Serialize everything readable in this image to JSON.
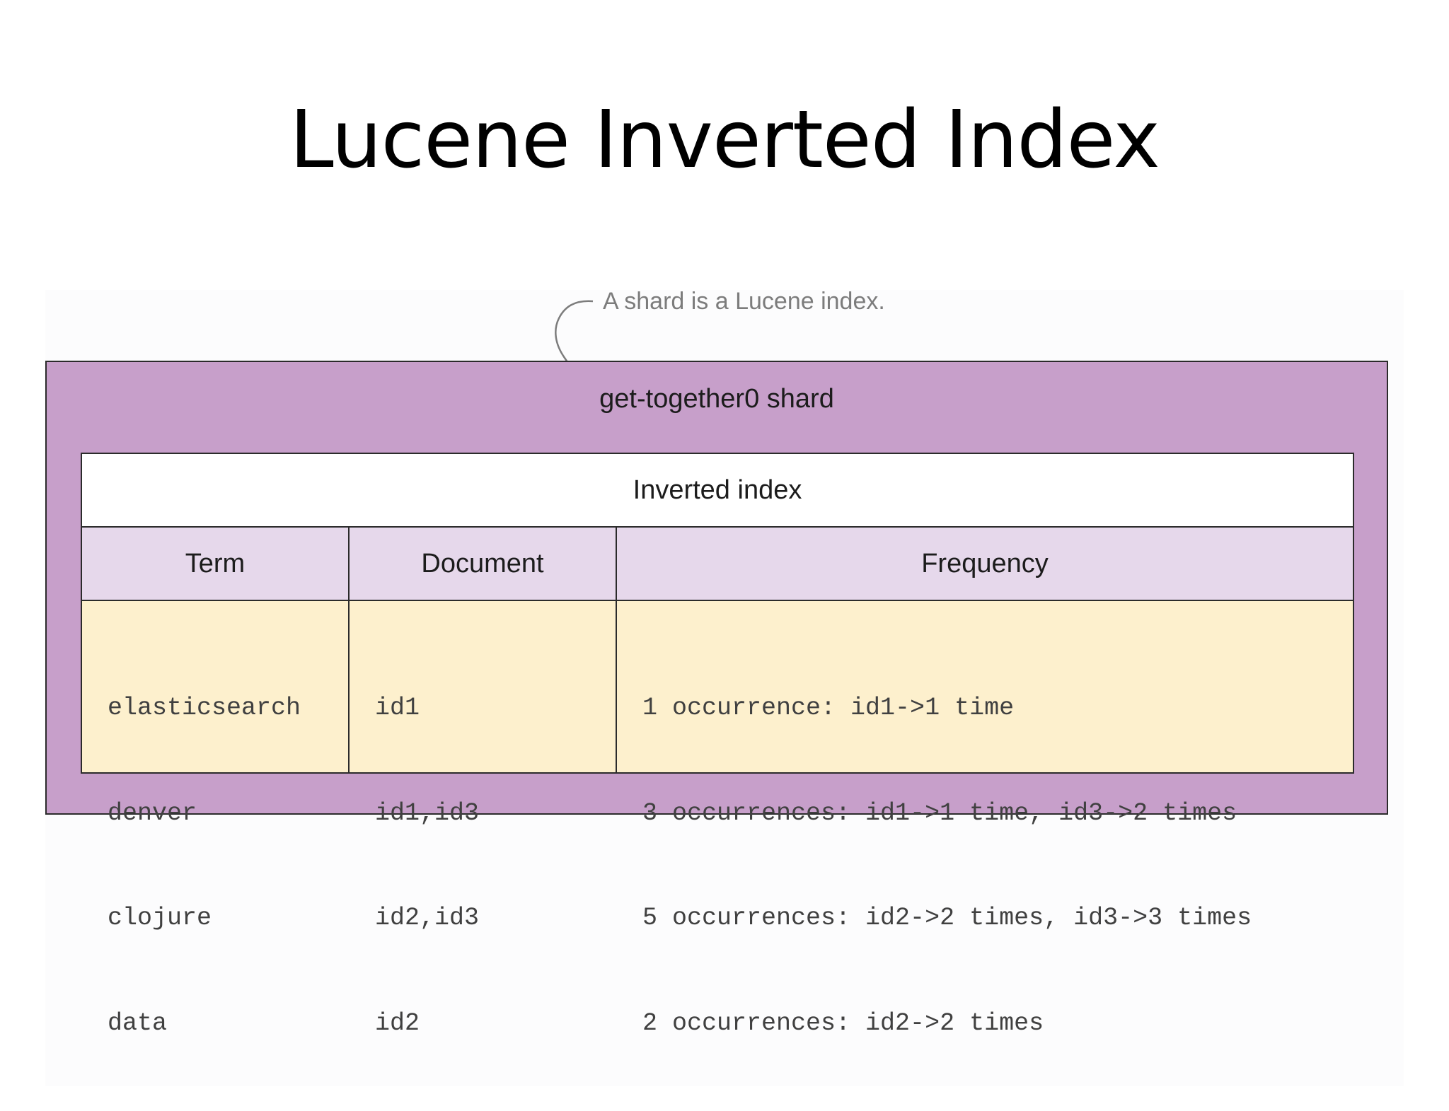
{
  "title": "Lucene Inverted Index",
  "callout": "A shard is a Lucene index.",
  "shard_label": "get-together0 shard",
  "index_title": "Inverted index",
  "columns": [
    "Term",
    "Document",
    "Frequency"
  ],
  "rows": [
    {
      "term": "elasticsearch",
      "document": "id1",
      "frequency": "1 occurrence: id1->1 time"
    },
    {
      "term": "denver",
      "document": "id1,id3",
      "frequency": "3 occurrences: id1->1 time, id3->2 times"
    },
    {
      "term": "clojure",
      "document": "id2,id3",
      "frequency": "5 occurrences: id2->2 times, id3->3 times"
    },
    {
      "term": "data",
      "document": "id2",
      "frequency": "2 occurrences: id2->2 times"
    }
  ],
  "colors": {
    "shard_fill": "#c79fca",
    "header_fill": "#e6d8eb",
    "body_fill": "#fdf0cd",
    "border": "#2b2b2b",
    "callout_text": "#7c7c7c"
  }
}
